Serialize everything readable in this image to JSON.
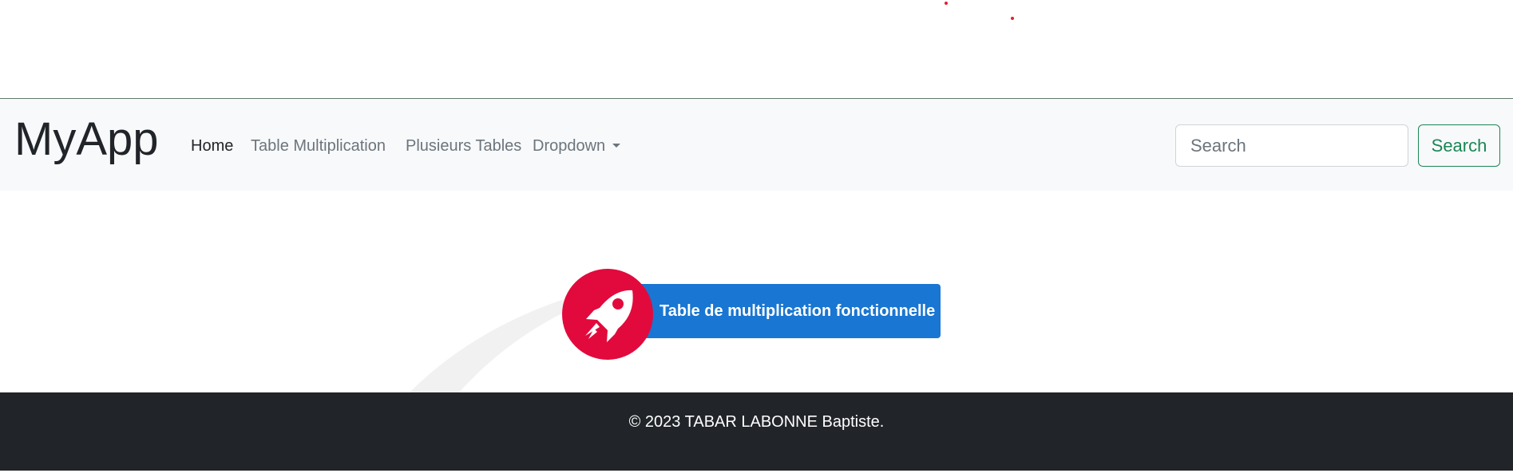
{
  "navbar": {
    "brand": "MyApp",
    "links": [
      {
        "label": "Home",
        "active": true
      },
      {
        "label": "Table Multiplication",
        "active": false
      },
      {
        "label": "Plusieurs Tables",
        "active": false
      },
      {
        "label": "Dropdown",
        "active": false
      }
    ],
    "search": {
      "placeholder": "Search",
      "value": "",
      "button_label": "Search"
    }
  },
  "main": {
    "cta_label": "Table de multiplication fonctionnelle",
    "cta_icon": "rocket-icon"
  },
  "footer": {
    "copyright": "© 2023 TABAR LABONNE Baptiste."
  },
  "colors": {
    "navbar_bg": "#f8f9fa",
    "cta_blue": "#1976d2",
    "rocket_red": "#e20a3c",
    "success_green": "#198754",
    "footer_bg": "#212529"
  }
}
